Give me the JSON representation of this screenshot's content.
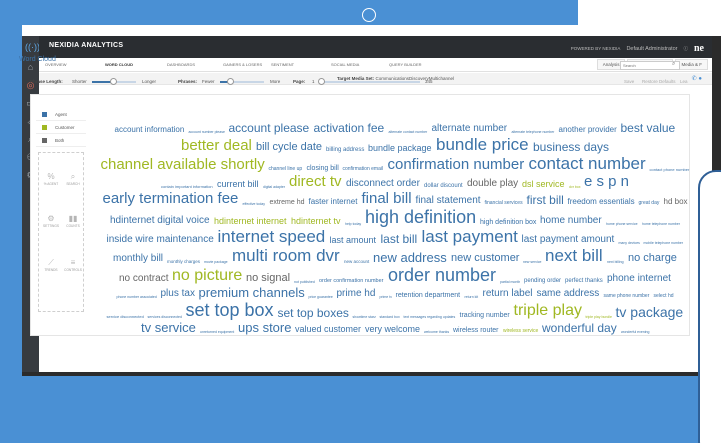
{
  "app": {
    "brand": "NEXIDIA ANALYTICS",
    "powered_by": "POWERED BY NEXIDIA",
    "user": "Default Administrator",
    "logo": "ne"
  },
  "nav": {
    "items": [
      "OVERVIEW",
      "WORD CLOUD",
      "DASHBOARDS",
      "GAINERS & LOSERS",
      "SENTIMENT",
      "SOCIAL MEDIA",
      "QUERY BUILDER"
    ],
    "active": "WORD CLOUD",
    "right_buttons": [
      "Analysis",
      "Manage Phrases",
      "Media & F"
    ]
  },
  "target": {
    "label": "Target Media Set:",
    "value": "CommunicationsDiscoveryMultichannel"
  },
  "wordcloud": {
    "title": "Word Cloud",
    "search_placeholder": "Search",
    "phrase_length_label": "Phrase Length:",
    "shorter": "Shorter",
    "longer": "Longer",
    "phrases_label": "Phrases:",
    "fewer": "Fewer",
    "more": "More",
    "page_label": "Page:",
    "page_value": "1",
    "page_total": "345",
    "save": "Save",
    "restore": "Restore Defaults",
    "gear": "Lea",
    "legend": [
      {
        "label": "Agent",
        "color": "#3c73a8"
      },
      {
        "label": "Customer",
        "color": "#a0b822"
      },
      {
        "label": "Both",
        "color": "#666666"
      }
    ],
    "tools": [
      "% AGENT",
      "SEARCH",
      "SETTINGS",
      "COUNTS",
      "TRENDS",
      "CONTROLS"
    ]
  },
  "words": [
    {
      "t": "account information",
      "c": "#3c73a8",
      "s": 8
    },
    {
      "t": "account number please",
      "c": "#3c73a8",
      "s": 3.5
    },
    {
      "t": "account please",
      "c": "#3c73a8",
      "s": 12
    },
    {
      "t": "activation fee",
      "c": "#3c73a8",
      "s": 12
    },
    {
      "t": "alternate contact number",
      "c": "#3c73a8",
      "s": 3.5
    },
    {
      "t": "alternate number",
      "c": "#3c73a8",
      "s": 10
    },
    {
      "t": "alternate telephone number",
      "c": "#3c73a8",
      "s": 3.5
    },
    {
      "t": "another provider",
      "c": "#3c73a8",
      "s": 8
    },
    {
      "t": "best value",
      "c": "#3c73a8",
      "s": 12
    },
    {
      "t": "better deal",
      "c": "#a0b822",
      "s": 15
    },
    {
      "t": "bill cycle date",
      "c": "#3c73a8",
      "s": 11
    },
    {
      "t": "billing address",
      "c": "#3c73a8",
      "s": 6
    },
    {
      "t": "bundle package",
      "c": "#3c73a8",
      "s": 9
    },
    {
      "t": "bundle price",
      "c": "#3c73a8",
      "s": 17
    },
    {
      "t": "business days",
      "c": "#3c73a8",
      "s": 12
    },
    {
      "t": "channel available shortly",
      "c": "#a0b822",
      "s": 15
    },
    {
      "t": "channel line up",
      "c": "#3c73a8",
      "s": 5
    },
    {
      "t": "closing bill",
      "c": "#3c73a8",
      "s": 7
    },
    {
      "t": "confirmation email",
      "c": "#3c73a8",
      "s": 5
    },
    {
      "t": "confirmation number",
      "c": "#3c73a8",
      "s": 15
    },
    {
      "t": "contact number",
      "c": "#3c73a8",
      "s": 17
    },
    {
      "t": "contact phone number",
      "c": "#3c73a8",
      "s": 4
    },
    {
      "t": "contain important information",
      "c": "#3c73a8",
      "s": 4
    },
    {
      "t": "current bill",
      "c": "#3c73a8",
      "s": 9
    },
    {
      "t": "digital adapter",
      "c": "#3c73a8",
      "s": 3.5
    },
    {
      "t": "direct tv",
      "c": "#a0b822",
      "s": 15
    },
    {
      "t": "disconnect order",
      "c": "#3c73a8",
      "s": 10
    },
    {
      "t": "dollar discount",
      "c": "#3c73a8",
      "s": 6
    },
    {
      "t": "double play",
      "c": "#666666",
      "s": 10
    },
    {
      "t": "dsl service",
      "c": "#a0b822",
      "s": 9
    },
    {
      "t": "dvr box",
      "c": "#a0b822",
      "s": 3.5
    },
    {
      "t": "e s p n",
      "c": "#3c73a8",
      "s": 15
    },
    {
      "t": "early termination fee",
      "c": "#3c73a8",
      "s": 15
    },
    {
      "t": "effective today",
      "c": "#3c73a8",
      "s": 3.5
    },
    {
      "t": "extreme hd",
      "c": "#666666",
      "s": 7
    },
    {
      "t": "faster internet",
      "c": "#3c73a8",
      "s": 8
    },
    {
      "t": "final bill",
      "c": "#3c73a8",
      "s": 15
    },
    {
      "t": "final statement",
      "c": "#3c73a8",
      "s": 10
    },
    {
      "t": "financial services",
      "c": "#3c73a8",
      "s": 5
    },
    {
      "t": "first bill",
      "c": "#3c73a8",
      "s": 12
    },
    {
      "t": "freedom essentials",
      "c": "#3c73a8",
      "s": 8
    },
    {
      "t": "great day",
      "c": "#3c73a8",
      "s": 5
    },
    {
      "t": "hd box",
      "c": "#666666",
      "s": 8
    },
    {
      "t": "hdinternet digital voice",
      "c": "#3c73a8",
      "s": 10
    },
    {
      "t": "hdinternet internet",
      "c": "#a0b822",
      "s": 9
    },
    {
      "t": "hdinternet tv",
      "c": "#a0b822",
      "s": 9
    },
    {
      "t": "help today",
      "c": "#3c73a8",
      "s": 3.5
    },
    {
      "t": "high definition",
      "c": "#3c73a8",
      "s": 18
    },
    {
      "t": "high definition box",
      "c": "#3c73a8",
      "s": 7
    },
    {
      "t": "home number",
      "c": "#3c73a8",
      "s": 10
    },
    {
      "t": "home phone service",
      "c": "#3c73a8",
      "s": 3.5
    },
    {
      "t": "home telephone number",
      "c": "#3c73a8",
      "s": 3.5
    },
    {
      "t": "inside wire maintenance",
      "c": "#3c73a8",
      "s": 10
    },
    {
      "t": "internet speed",
      "c": "#3c73a8",
      "s": 17
    },
    {
      "t": "last amount",
      "c": "#3c73a8",
      "s": 9
    },
    {
      "t": "last bill",
      "c": "#3c73a8",
      "s": 12
    },
    {
      "t": "last payment",
      "c": "#3c73a8",
      "s": 17
    },
    {
      "t": "last payment amount",
      "c": "#3c73a8",
      "s": 10
    },
    {
      "t": "many devices",
      "c": "#3c73a8",
      "s": 3.5
    },
    {
      "t": "mobile telephone number",
      "c": "#3c73a8",
      "s": 3.5
    },
    {
      "t": "monthly bill",
      "c": "#3c73a8",
      "s": 10
    },
    {
      "t": "monthly charges",
      "c": "#3c73a8",
      "s": 4.5
    },
    {
      "t": "movie package",
      "c": "#3c73a8",
      "s": 3.5
    },
    {
      "t": "multi room dvr",
      "c": "#3c73a8",
      "s": 17
    },
    {
      "t": "new account",
      "c": "#3c73a8",
      "s": 4.5
    },
    {
      "t": "new address",
      "c": "#3c73a8",
      "s": 13
    },
    {
      "t": "new customer",
      "c": "#3c73a8",
      "s": 11
    },
    {
      "t": "new service",
      "c": "#3c73a8",
      "s": 3.5
    },
    {
      "t": "next bill",
      "c": "#3c73a8",
      "s": 17
    },
    {
      "t": "next billing",
      "c": "#3c73a8",
      "s": 3.5
    },
    {
      "t": "no charge",
      "c": "#3c73a8",
      "s": 11
    },
    {
      "t": "no contract",
      "c": "#666666",
      "s": 10
    },
    {
      "t": "no picture",
      "c": "#a0b822",
      "s": 16
    },
    {
      "t": "no signal",
      "c": "#666666",
      "s": 11
    },
    {
      "t": "not published",
      "c": "#3c73a8",
      "s": 3.5
    },
    {
      "t": "order confirmation number",
      "c": "#3c73a8",
      "s": 5.5
    },
    {
      "t": "order number",
      "c": "#3c73a8",
      "s": 18
    },
    {
      "t": "partial month",
      "c": "#3c73a8",
      "s": 3.5
    },
    {
      "t": "pending order",
      "c": "#3c73a8",
      "s": 6
    },
    {
      "t": "perfect thanks",
      "c": "#3c73a8",
      "s": 6
    },
    {
      "t": "phone internet",
      "c": "#3c73a8",
      "s": 10
    },
    {
      "t": "phone number associated",
      "c": "#3c73a8",
      "s": 3.5
    },
    {
      "t": "plus tax",
      "c": "#3c73a8",
      "s": 10
    },
    {
      "t": "premium channels",
      "c": "#3c73a8",
      "s": 13
    },
    {
      "t": "price guarantee",
      "c": "#3c73a8",
      "s": 3.5
    },
    {
      "t": "prime hd",
      "c": "#3c73a8",
      "s": 10
    },
    {
      "t": "prime tv",
      "c": "#3c73a8",
      "s": 3.5
    },
    {
      "t": "retention department",
      "c": "#3c73a8",
      "s": 7
    },
    {
      "t": "return kit",
      "c": "#3c73a8",
      "s": 3.5
    },
    {
      "t": "return label",
      "c": "#3c73a8",
      "s": 10
    },
    {
      "t": "same address",
      "c": "#3c73a8",
      "s": 10
    },
    {
      "t": "same phone number",
      "c": "#3c73a8",
      "s": 5
    },
    {
      "t": "select hd",
      "c": "#3c73a8",
      "s": 5
    },
    {
      "t": "service disconnected",
      "c": "#3c73a8",
      "s": 4
    },
    {
      "t": "services disconnected",
      "c": "#3c73a8",
      "s": 3.5
    },
    {
      "t": "set top box",
      "c": "#3c73a8",
      "s": 18
    },
    {
      "t": "set top boxes",
      "c": "#3c73a8",
      "s": 12
    },
    {
      "t": "showtime starz",
      "c": "#3c73a8",
      "s": 3.5
    },
    {
      "t": "standard box",
      "c": "#3c73a8",
      "s": 3.5
    },
    {
      "t": "text messages regarding updates",
      "c": "#3c73a8",
      "s": 3.5
    },
    {
      "t": "tracking number",
      "c": "#3c73a8",
      "s": 7
    },
    {
      "t": "triple play",
      "c": "#a0b822",
      "s": 16
    },
    {
      "t": "triple play bundle",
      "c": "#a0b822",
      "s": 3.5
    },
    {
      "t": "tv package",
      "c": "#3c73a8",
      "s": 14
    },
    {
      "t": "tv service",
      "c": "#3c73a8",
      "s": 13
    },
    {
      "t": "unreturned equipment",
      "c": "#3c73a8",
      "s": 3.5
    },
    {
      "t": "ups store",
      "c": "#3c73a8",
      "s": 13
    },
    {
      "t": "valued customer",
      "c": "#3c73a8",
      "s": 9
    },
    {
      "t": "very welcome",
      "c": "#3c73a8",
      "s": 9
    },
    {
      "t": "welcome thanks",
      "c": "#3c73a8",
      "s": 3.5
    },
    {
      "t": "wireless router",
      "c": "#3c73a8",
      "s": 7
    },
    {
      "t": "wireless service",
      "c": "#a0b822",
      "s": 5
    },
    {
      "t": "wonderful day",
      "c": "#3c73a8",
      "s": 12
    },
    {
      "t": "wonderful evening",
      "c": "#3c73a8",
      "s": 3.5
    }
  ]
}
